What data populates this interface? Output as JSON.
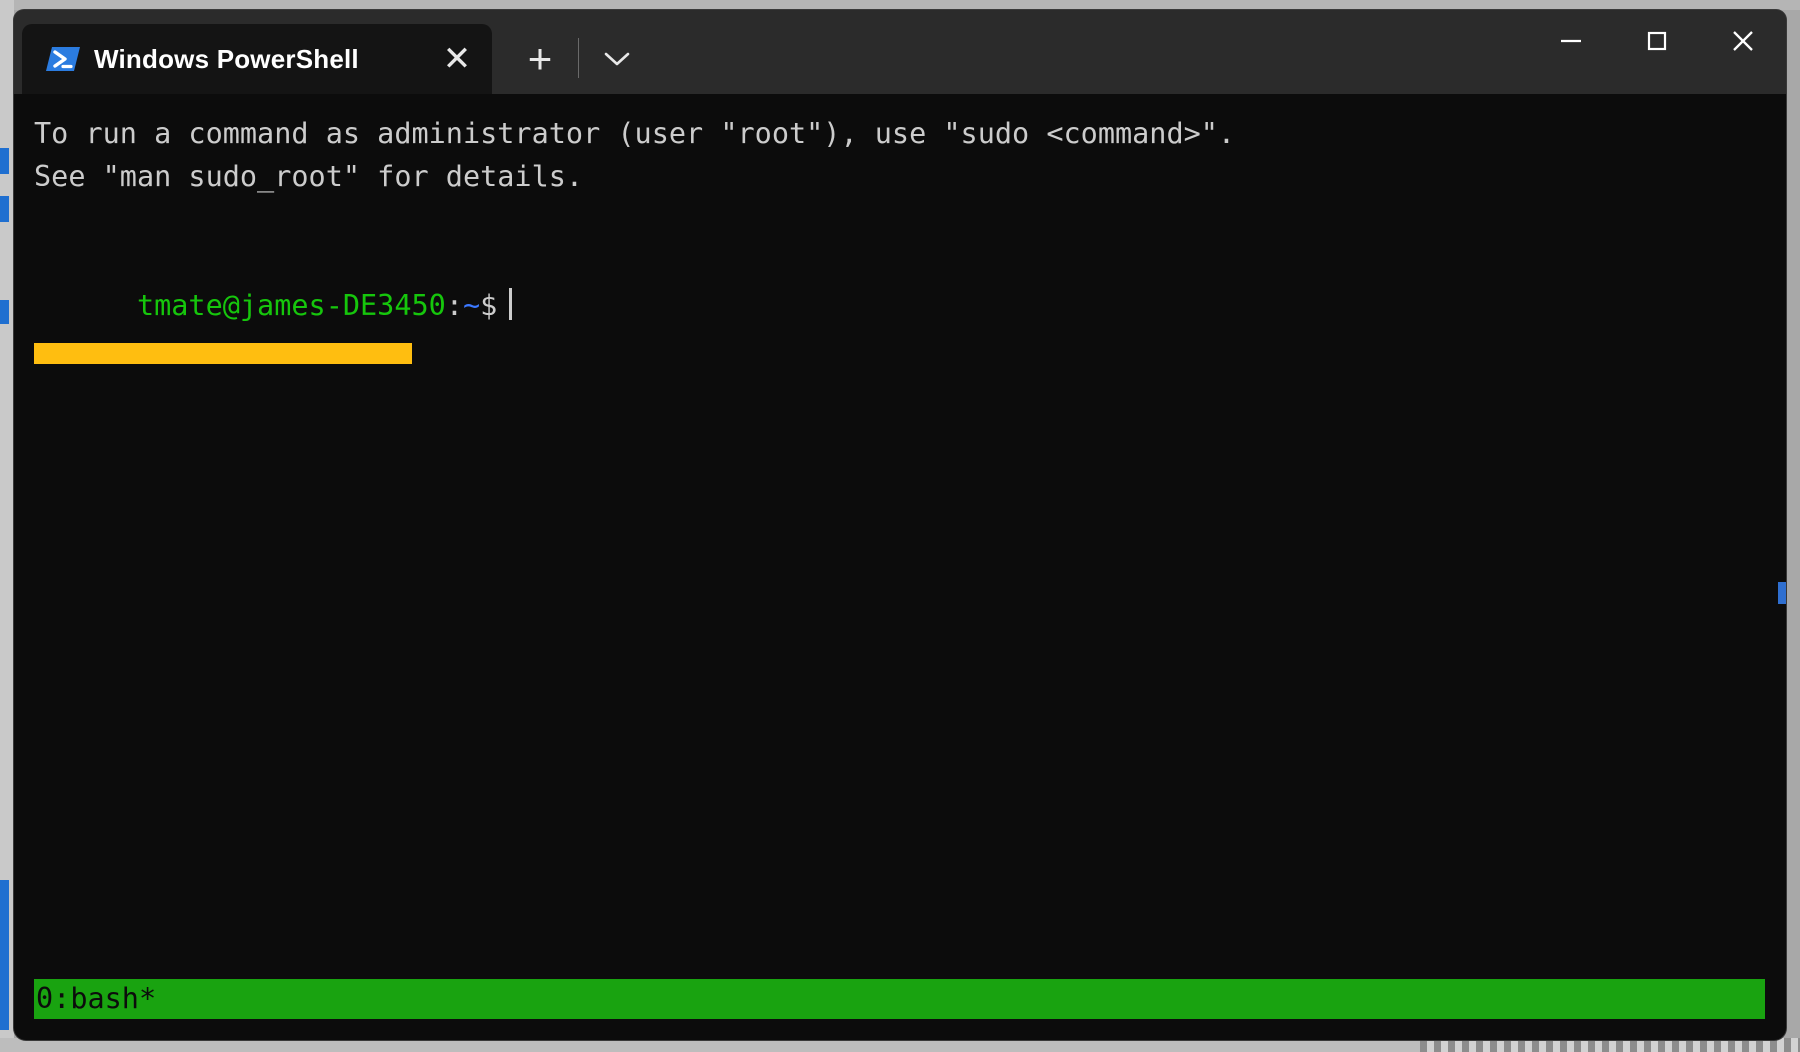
{
  "window": {
    "app_name": "Windows PowerShell",
    "controls": {
      "minimize_label": "—",
      "maximize_label": "□",
      "close_label": "✕"
    }
  },
  "tab_bar": {
    "tabs": [
      {
        "title": "Windows PowerShell",
        "icon": "powershell-icon",
        "close_label": "✕",
        "active": true
      }
    ],
    "new_tab_label": "+",
    "dropdown_label": "⌵"
  },
  "terminal": {
    "lines": [
      {
        "id": "line-sudo-hint",
        "text": "To run a command as administrator (user \"root\"), use \"sudo <command>\"."
      },
      {
        "id": "line-man-hint",
        "text": "See \"man sudo_root\" for details."
      }
    ],
    "prompt": {
      "user_host": "tmate@james-DE3450",
      "separator": ":",
      "path": "~",
      "symbol": "$",
      "input_value": ""
    },
    "highlight_color": "#ffbe10",
    "text_color": "#cccccc",
    "prompt_color": "#16c60c",
    "path_color": "#3b78ff",
    "background_color": "#0c0c0c"
  },
  "status_bar": {
    "text": "0:bash*",
    "background_color": "#19a310",
    "text_color": "#0c0c0c"
  }
}
